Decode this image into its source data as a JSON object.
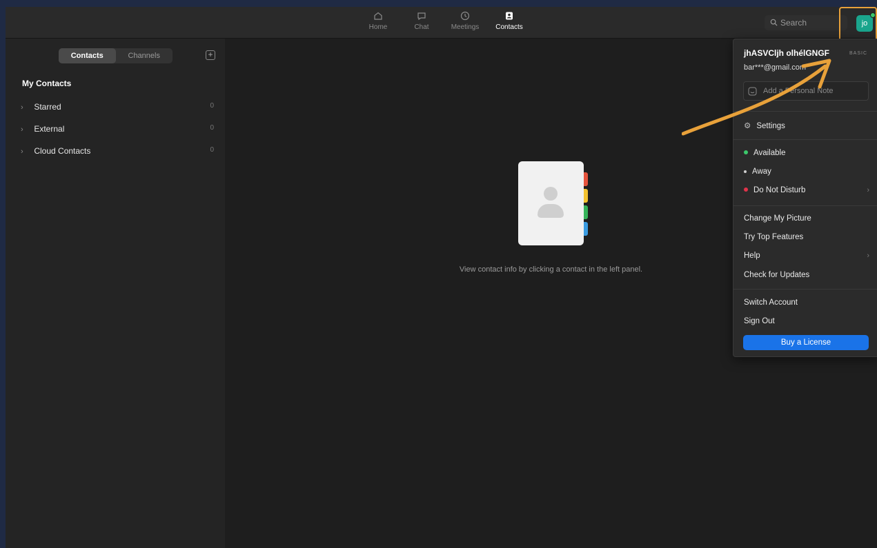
{
  "nav": {
    "tabs": [
      {
        "label": "Home",
        "icon": "home-icon"
      },
      {
        "label": "Chat",
        "icon": "chat-icon"
      },
      {
        "label": "Meetings",
        "icon": "clock-icon"
      },
      {
        "label": "Contacts",
        "icon": "contacts-icon"
      }
    ],
    "active": "Contacts"
  },
  "search": {
    "placeholder": "Search"
  },
  "avatar": {
    "initials": "jo",
    "status_color": "#3cc86b"
  },
  "sidebar": {
    "segments": [
      "Contacts",
      "Channels"
    ],
    "add_label": "+",
    "section_title": "My Contacts",
    "groups": [
      {
        "label": "Starred",
        "count": "0"
      },
      {
        "label": "External",
        "count": "0"
      },
      {
        "label": "Cloud Contacts",
        "count": "0"
      }
    ]
  },
  "main": {
    "hint": "View contact info by clicking a contact in the left panel."
  },
  "menu": {
    "username": "jhASVClјh olhélGNGF",
    "plan_badge": "BASIC",
    "email": "bar***@gmail.com",
    "note_placeholder": "Add a Personal Note",
    "settings": "Settings",
    "statuses": [
      {
        "label": "Available",
        "color": "#3cc86b"
      },
      {
        "label": "Away",
        "color": "#cfcfcf"
      },
      {
        "label": "Do Not Disturb",
        "color": "#e0334a"
      }
    ],
    "items1": [
      "Change My Picture",
      "Try Top Features",
      "Help",
      "Check for Updates"
    ],
    "items2": [
      "Switch Account",
      "Sign Out"
    ],
    "buy": "Buy a License"
  },
  "colors": {
    "accent": "#1a73e8",
    "annotation": "#e8a13a",
    "avatar": "#1aa58d"
  }
}
